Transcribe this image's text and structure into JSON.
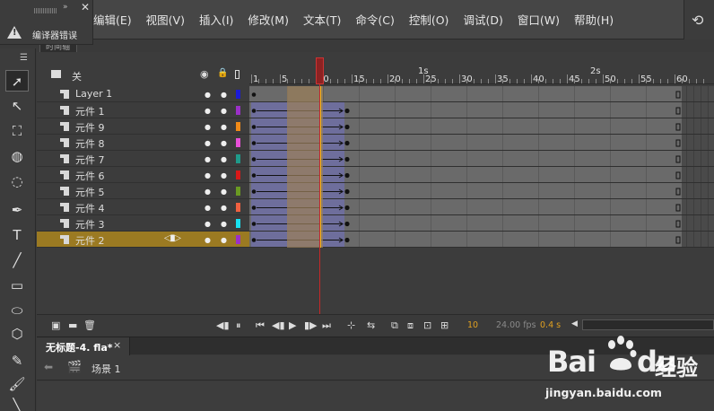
{
  "compile_panel": {
    "label": "编译器错误"
  },
  "menus": [
    "编辑(E)",
    "视图(V)",
    "插入(I)",
    "修改(M)",
    "文本(T)",
    "命令(C)",
    "控制(O)",
    "调试(D)",
    "窗口(W)",
    "帮助(H)"
  ],
  "timeline": {
    "panel_tab": "时间轴",
    "header_label": "关",
    "layers": [
      {
        "name": "Layer 1",
        "color": "#1b1bd6",
        "selected": false,
        "tween": false
      },
      {
        "name": "元件 1",
        "color": "#9b30c8",
        "selected": false,
        "tween": true
      },
      {
        "name": "元件 9",
        "color": "#f08a18",
        "selected": false,
        "tween": true
      },
      {
        "name": "元件 8",
        "color": "#e850d8",
        "selected": false,
        "tween": true
      },
      {
        "name": "元件 7",
        "color": "#1f9a8a",
        "selected": false,
        "tween": true
      },
      {
        "name": "元件 6",
        "color": "#d81818",
        "selected": false,
        "tween": true
      },
      {
        "name": "元件 5",
        "color": "#6a9a22",
        "selected": false,
        "tween": true
      },
      {
        "name": "元件 4",
        "color": "#f06040",
        "selected": false,
        "tween": true
      },
      {
        "name": "元件 3",
        "color": "#18e0f0",
        "selected": false,
        "tween": true
      },
      {
        "name": "元件 2",
        "color": "#9b30c8",
        "selected": true,
        "tween": true
      }
    ],
    "ruler_frames": [
      "1",
      "5",
      "10",
      "15",
      "20",
      "25",
      "30",
      "35",
      "40",
      "45",
      "50",
      "55",
      "60"
    ],
    "ruler_frame_numbers": [
      1,
      5,
      10,
      15,
      20,
      25,
      30,
      35,
      40,
      45,
      50,
      55,
      60
    ],
    "ruler_seconds": [
      {
        "label": "1s",
        "frame": 24
      },
      {
        "label": "2s",
        "frame": 48
      }
    ],
    "total_frames": 60,
    "tween_start": 1,
    "tween_end": 14,
    "onion_start": 6,
    "onion_end": 10,
    "current_frame": 10,
    "footer": {
      "current_frame": "10",
      "fps": "24.00 fps",
      "time": "0.4 s"
    }
  },
  "document": {
    "tab_title": "无标题-4. fla*",
    "close": "×",
    "scene": "场景 1"
  },
  "watermark": {
    "brand": "Bai",
    "brand_tail": "du",
    "brand_cn": "经验",
    "url": "jingyan.baidu.com"
  },
  "colors": {
    "tween": "#6e6e9c",
    "onion": "#9b7f5a",
    "playhead": "#c62828",
    "selected_layer": "#9b7a22",
    "accent_orange": "#e0a020"
  }
}
